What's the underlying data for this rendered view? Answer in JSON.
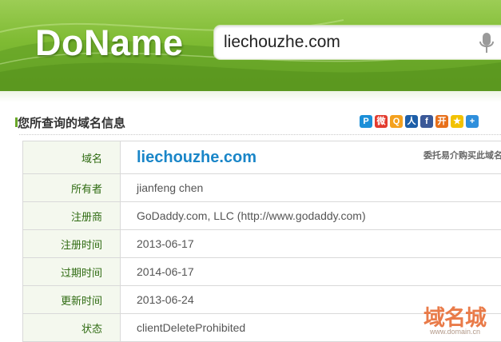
{
  "header": {
    "logo": "DoName",
    "search_value": "liechouzhe.com"
  },
  "section": {
    "title": "您所查询的域名信息"
  },
  "share_icons": [
    {
      "name": "qzone-icon",
      "color": "#1b8fd8",
      "glyph": "P"
    },
    {
      "name": "weibo-icon",
      "color": "#e33b2e",
      "glyph": "微"
    },
    {
      "name": "tencent-weibo-icon",
      "color": "#f4a11e",
      "glyph": "Q"
    },
    {
      "name": "renren-icon",
      "color": "#1d5ea8",
      "glyph": "人"
    },
    {
      "name": "facebook-icon",
      "color": "#3b5998",
      "glyph": "f"
    },
    {
      "name": "kaixin-icon",
      "color": "#e8701a",
      "glyph": "开"
    },
    {
      "name": "pengyou-icon",
      "color": "#f2c200",
      "glyph": "★"
    },
    {
      "name": "more-share-icon",
      "color": "#2f8fdc",
      "glyph": "+"
    }
  ],
  "domain_info": {
    "rows": [
      {
        "label": "域名",
        "value": "liechouzhe.com"
      },
      {
        "label": "所有者",
        "value": "jianfeng chen"
      },
      {
        "label": "注册商",
        "value": "GoDaddy.com, LLC (http://www.godaddy.com)"
      },
      {
        "label": "注册时间",
        "value": "2013-06-17"
      },
      {
        "label": "过期时间",
        "value": "2014-06-17"
      },
      {
        "label": "更新时间",
        "value": "2013-06-24"
      },
      {
        "label": "状态",
        "value": "clientDeleteProhibited"
      }
    ],
    "broker_link": "委托易介购买此域名"
  },
  "watermark": {
    "brand": "域名城",
    "url": "www.domain.cn"
  },
  "colors": {
    "header_green": "#7fbb33",
    "label_green": "#2f6b12",
    "domain_blue": "#1a86c8",
    "watermark_orange": "#e8703a"
  }
}
